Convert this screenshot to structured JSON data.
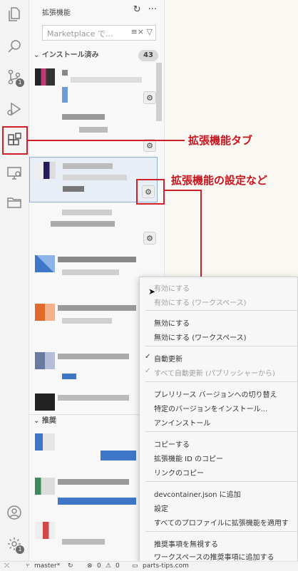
{
  "sidebar": {
    "title": "拡張機能",
    "search_placeholder": "Marketplace で...",
    "installed_header": "インストール済み",
    "installed_count": "43",
    "recommended_header": "推奨"
  },
  "activity_bar": {
    "scm_badge": "1",
    "icons": [
      "explorer-icon",
      "search-icon",
      "source-control-icon",
      "run-debug-icon",
      "extensions-icon",
      "remote-explorer-icon",
      "folder-icon",
      "account-icon",
      "manage-icon"
    ]
  },
  "callouts": {
    "tab_label": "拡張機能タブ",
    "settings_label": "拡張機能の設定など"
  },
  "context_menu": {
    "groups": [
      [
        {
          "label": "有効にする",
          "disabled": true
        },
        {
          "label": "有効にする (ワークスペース)",
          "disabled": true
        }
      ],
      [
        {
          "label": "無効にする"
        },
        {
          "label": "無効にする (ワークスペース)"
        }
      ],
      [
        {
          "label": "自動更新",
          "checked": true
        },
        {
          "label": "すべて自動更新 (パブリッシャーから)",
          "checked": true,
          "disabled": true
        }
      ],
      [
        {
          "label": "プレリリース バージョンへの切り替え"
        },
        {
          "label": "特定のバージョンをインストール..."
        },
        {
          "label": "アンインストール"
        }
      ],
      [
        {
          "label": "コピーする"
        },
        {
          "label": "拡張機能 ID のコピー"
        },
        {
          "label": "リンクのコピー"
        }
      ],
      [
        {
          "label": "devcontainer.json に追加"
        },
        {
          "label": "設定"
        },
        {
          "label": "すべてのプロファイルに拡張機能を適用す"
        }
      ],
      [
        {
          "label": "推奨事項を無視する"
        },
        {
          "label": "ワークスペースの推奨事項に追加する"
        }
      ]
    ]
  },
  "statusbar": {
    "branch": "master*",
    "errors": "0",
    "warnings": "0",
    "folder": "parts-tips.com"
  },
  "colors": {
    "highlight": "#d0202a",
    "callout_text": "#c8141e"
  }
}
